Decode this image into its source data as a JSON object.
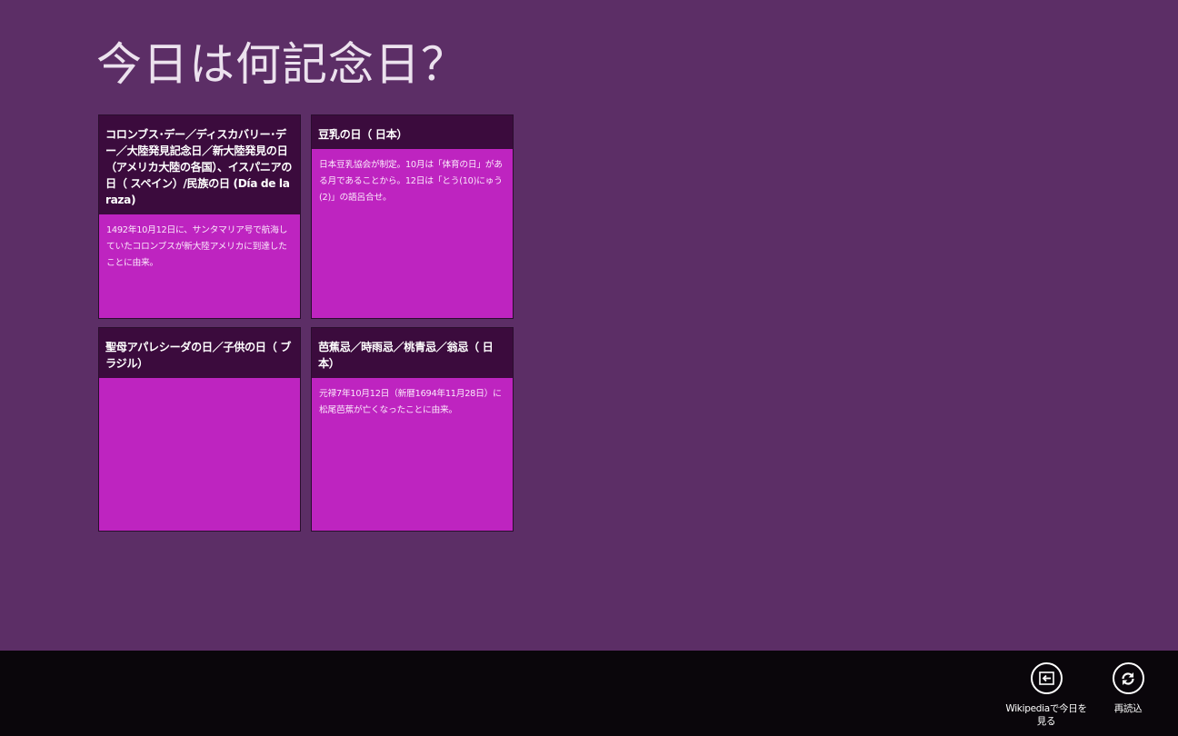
{
  "app": {
    "title": "今日は何記念日？"
  },
  "tiles": [
    {
      "heading": "コロンブス･デー／ディスカバリー･デー／大陸発見記念日／新大陸発見の日（アメリカ大陸の各国）、イスパニアの日（ スペイン）/民族の日 (Día de la raza)",
      "description": "1492年10月12日に、サンタマリア号で航海していたコロンブスが新大陸アメリカに到達したことに由来。"
    },
    {
      "heading": "豆乳の日（ 日本）",
      "description": "日本豆乳協会が制定。10月は「体育の日」がある月であることから。12日は「とう(10)にゅう(2)」の語呂合せ。"
    },
    {
      "heading": "聖母アパレシーダの日／子供の日（ ブラジル）",
      "description": ""
    },
    {
      "heading": "芭蕉忌／時雨忌／桃青忌／翁忌（ 日本）",
      "description": "元禄7年10月12日（新暦1694年11月28日）に松尾芭蕉が亡くなったことに由来。"
    }
  ],
  "appbar": {
    "wikipedia_label": "Wikipediaで今日を見る",
    "wikipedia_icon": "open-in-browser-icon",
    "reload_label": "再読込",
    "reload_icon": "refresh-icon"
  },
  "colors": {
    "page_background": "#5c2e66",
    "tile_background": "#be24c0",
    "tile_header_background": "#3b0b3d",
    "appbar_background": "#0a060b"
  }
}
